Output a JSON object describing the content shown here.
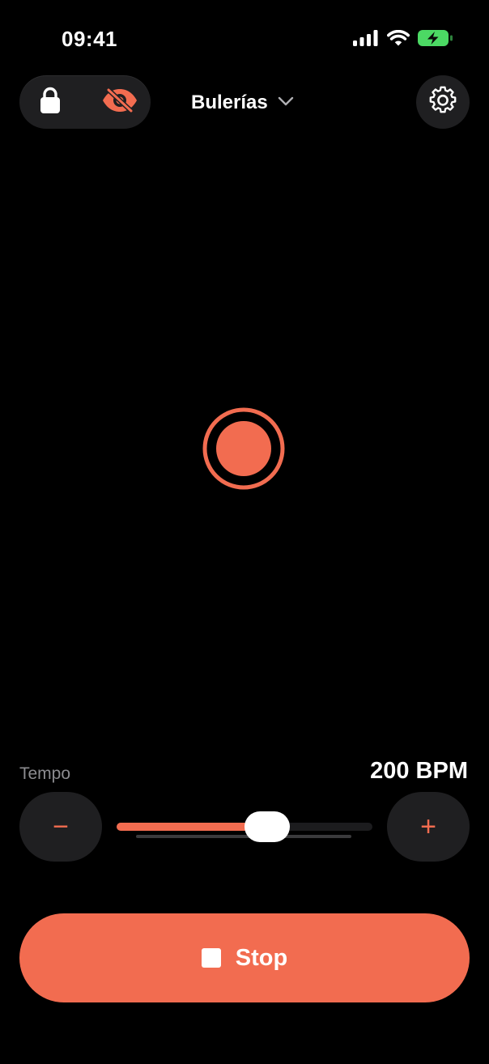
{
  "status_bar": {
    "time": "09:41",
    "icons": [
      "cellular-signal-icon",
      "wifi-icon",
      "battery-charging-icon"
    ],
    "battery_color": "#4cd964"
  },
  "header": {
    "toggle_icons": [
      "lock-icon",
      "eye-slash-icon"
    ],
    "rhythm": "Bulerías",
    "settings_icon": "gear-icon"
  },
  "beat_indicator": {
    "color": "#f26c50"
  },
  "tempo": {
    "label": "Tempo",
    "value_text": "200 BPM",
    "decrement": "−",
    "increment": "+",
    "slider_position": 0.59
  },
  "stop_button": {
    "label": "Stop",
    "icon": "stop-icon"
  },
  "colors": {
    "accent": "#f26c50",
    "background": "#000000",
    "control_bg": "#1f1f21"
  }
}
